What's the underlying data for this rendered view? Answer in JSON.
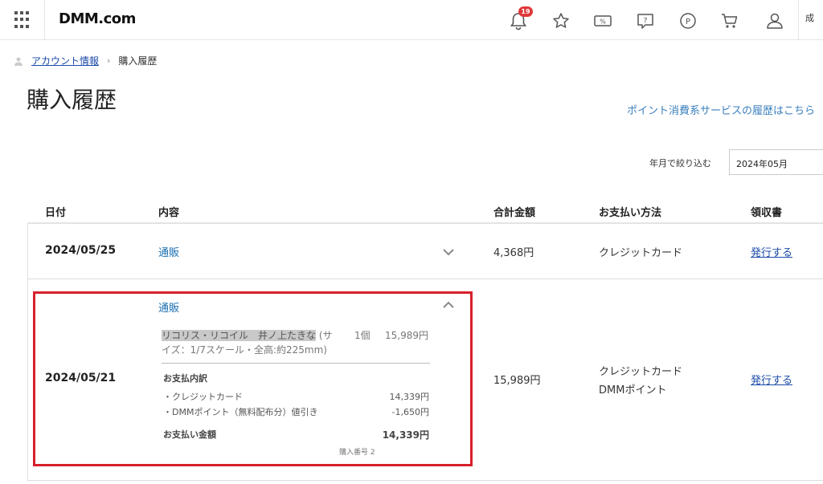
{
  "header": {
    "logo": "DMM.com",
    "notification_count": "19",
    "cut_text": "成",
    "icons": [
      "grid-menu-icon",
      "bell-icon",
      "star-icon",
      "coupon-icon",
      "help-icon",
      "point-icon",
      "cart-icon",
      "user-icon"
    ]
  },
  "breadcrumb": {
    "parent": "アカウント情報",
    "separator": "›",
    "current": "購入履歴"
  },
  "page": {
    "title": "購入履歴",
    "point_link": "ポイント消費系サービスの履歴はこちら",
    "filter_label": "年月で絞り込む",
    "filter_value": "2024年05月"
  },
  "table": {
    "headers": {
      "date": "日付",
      "content": "内容",
      "total": "合計金額",
      "payment": "お支払い方法",
      "receipt": "領収書"
    },
    "rows": [
      {
        "date": "2024/05/25",
        "content": "通販",
        "total": "4,368円",
        "payment": "クレジットカード",
        "receipt": "発行する"
      },
      {
        "date": "2024/05/21",
        "content": "通販",
        "total": "15,989円",
        "payment_line1": "クレジットカード",
        "payment_line2": "DMMポイント",
        "receipt": "発行する",
        "detail": {
          "item_name_highlight": "リコリス・リコイル　井ノ上たきな",
          "item_name_rest_1": " (サ",
          "item_name_rest_2": "イズ：1/7スケール・全高:約225mm)",
          "qty": "1個",
          "price": "15,989円",
          "breakdown_title": "お支払内訳",
          "credit_label": "・クレジットカード",
          "credit_value": "14,339円",
          "point_label": "・DMMポイント（無料配布分）値引き",
          "point_value": "-1,650円",
          "paid_label": "お支払い金額",
          "paid_value": "14,339円",
          "order_no": "購入番号 2"
        }
      }
    ]
  },
  "colors": {
    "highlight_box": "#d8202b",
    "link_blue": "#1a4aa8",
    "accent_blue": "#3a7fbe",
    "badge_red": "#e0393b"
  }
}
